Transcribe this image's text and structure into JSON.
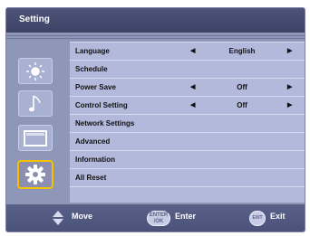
{
  "window": {
    "title": "Setting"
  },
  "sidebar": {
    "items": [
      {
        "icon": "brightness-icon"
      },
      {
        "icon": "music-note-icon"
      },
      {
        "icon": "screen-icon"
      },
      {
        "icon": "gear-icon",
        "selected": true
      }
    ]
  },
  "menu": {
    "rows": [
      {
        "label": "Language",
        "value": "English",
        "left_arrow": "◀",
        "right_arrow": "▶"
      },
      {
        "label": "Schedule"
      },
      {
        "label": "Power Save",
        "value": "Off",
        "left_arrow": "◀",
        "right_arrow": "▶"
      },
      {
        "label": "Control Setting",
        "value": "Off",
        "left_arrow": "◀",
        "right_arrow": "▶"
      },
      {
        "label": "Network Settings"
      },
      {
        "label": "Advanced"
      },
      {
        "label": "Information"
      },
      {
        "label": "All Reset"
      }
    ]
  },
  "footer": {
    "move_label": "Move",
    "enter_key_top": "ENTER",
    "enter_key_bottom": "/OK",
    "enter_label": "Enter",
    "exit_key": "EXIT",
    "exit_label": "Exit"
  },
  "colors": {
    "panel": "#8f97b8",
    "title_bar": "#474e72",
    "menu_bg": "#b2b9db",
    "selected_border": "#f4c300",
    "footer": "#525981"
  }
}
